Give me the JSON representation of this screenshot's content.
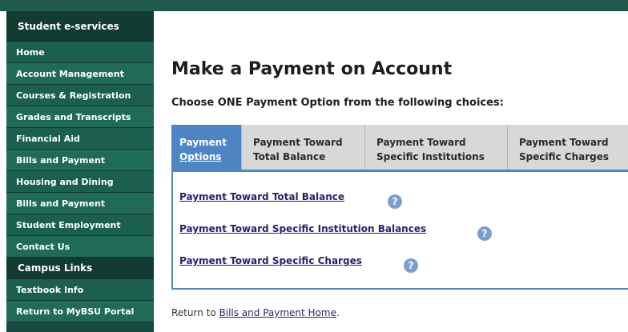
{
  "sidebar": {
    "header": "Student e-services",
    "items": [
      {
        "label": "Home"
      },
      {
        "label": "Account Management"
      },
      {
        "label": "Courses & Registration"
      },
      {
        "label": "Grades and Transcripts"
      },
      {
        "label": "Financial Aid"
      },
      {
        "label": "Bills and Payment"
      },
      {
        "label": "Housing and Dining"
      },
      {
        "label": "Bills and Payment"
      },
      {
        "label": "Student Employment"
      },
      {
        "label": "Contact Us"
      }
    ],
    "campus_header": "Campus Links",
    "campus_items": [
      {
        "label": "Textbook Info"
      },
      {
        "label": "Return to MyBSU Portal"
      }
    ]
  },
  "main": {
    "title": "Make a Payment on Account",
    "instruction": "Choose ONE Payment Option from the following choices:",
    "tabs": [
      {
        "line1": "Payment",
        "line2": "Options"
      },
      {
        "line1": "Payment Toward",
        "line2": "Total Balance"
      },
      {
        "line1": "Payment Toward",
        "line2": "Specific Institutions"
      },
      {
        "line1": "Payment Toward",
        "line2": "Specific Charges"
      }
    ],
    "options": [
      {
        "label": "Payment Toward Total Balance"
      },
      {
        "label": "Payment Toward Specific Institution Balances"
      },
      {
        "label": "Payment Toward Specific Charges"
      }
    ],
    "help_glyph": "?",
    "return_prefix": "Return to ",
    "return_link": "Bills and Payment Home",
    "return_suffix": "."
  },
  "colors": {
    "sidebar": "#174a3e",
    "sidebar_item": "#1f6b58",
    "tab_active": "#4d85c4",
    "link": "#2b1f6b"
  },
  "icons": {
    "help": "help-circle-icon"
  }
}
